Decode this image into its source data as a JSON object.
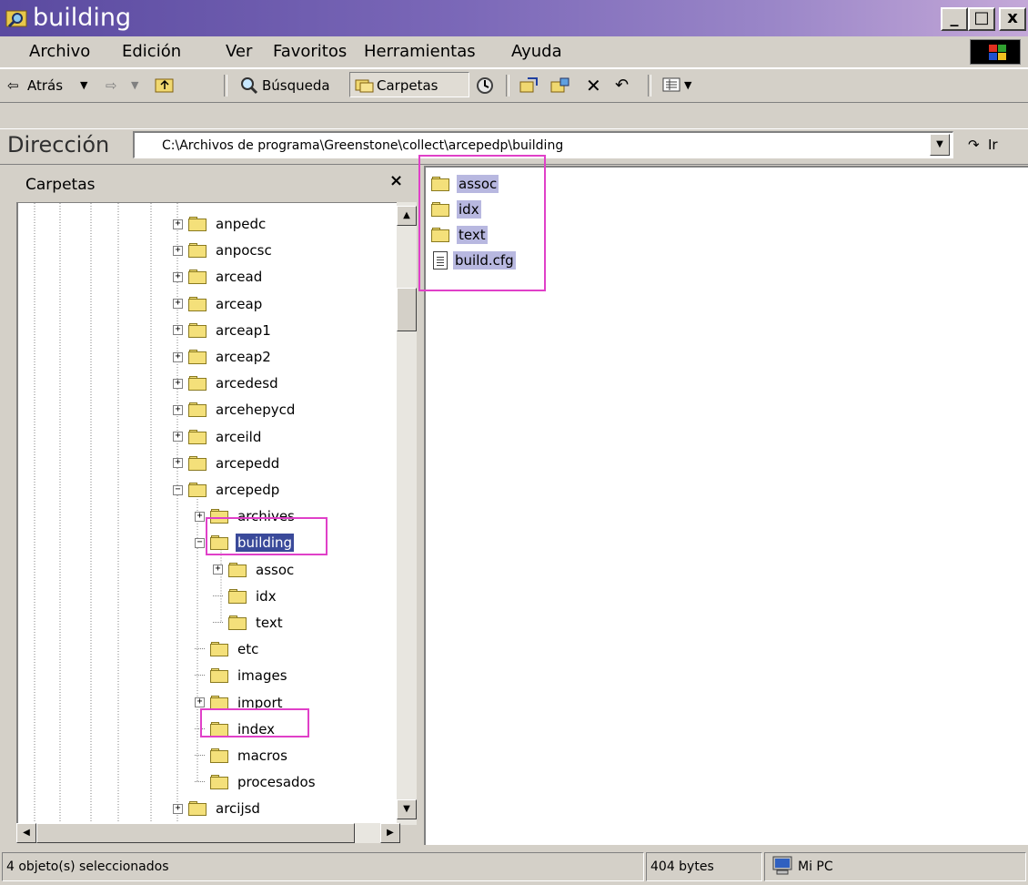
{
  "window": {
    "title": "building",
    "minimize": "_",
    "maximize": "□",
    "close": "x"
  },
  "menu": {
    "items": [
      "Archivo",
      "Edición",
      "Ver",
      "Favoritos",
      "Herramientas",
      "Ayuda"
    ]
  },
  "toolbar": {
    "back": "Atrás",
    "search": "Búsqueda",
    "folders": "Carpetas"
  },
  "address": {
    "label": "Dirección",
    "value": "C:\\Archivos de programa\\Greenstone\\collect\\arcepedp\\building",
    "go": "Ir"
  },
  "folder_pane": {
    "title": "Carpetas",
    "close": "×",
    "nodes": [
      {
        "label": "anpedc",
        "expander": "+"
      },
      {
        "label": "anpocsc",
        "expander": "+"
      },
      {
        "label": "arcead",
        "expander": "+"
      },
      {
        "label": "arceap",
        "expander": "+"
      },
      {
        "label": "arceap1",
        "expander": "+"
      },
      {
        "label": "arceap2",
        "expander": "+"
      },
      {
        "label": "arcedesd",
        "expander": "+"
      },
      {
        "label": "arcehepycd",
        "expander": "+"
      },
      {
        "label": "arceild",
        "expander": "+"
      },
      {
        "label": "arcepedd",
        "expander": "+"
      },
      {
        "label": "arcepedp",
        "expander": "−"
      },
      {
        "label": "archives",
        "expander": "+"
      },
      {
        "label": "building",
        "expander": "−",
        "selected": true
      },
      {
        "label": "assoc",
        "expander": "+"
      },
      {
        "label": "idx",
        "expander": ""
      },
      {
        "label": "text",
        "expander": ""
      },
      {
        "label": "etc",
        "expander": ""
      },
      {
        "label": "images",
        "expander": ""
      },
      {
        "label": "import",
        "expander": "+"
      },
      {
        "label": "index",
        "expander": ""
      },
      {
        "label": "macros",
        "expander": ""
      },
      {
        "label": "procesados",
        "expander": ""
      },
      {
        "label": "arcijsd",
        "expander": "+"
      }
    ]
  },
  "content": {
    "items": [
      {
        "label": "assoc",
        "type": "folder"
      },
      {
        "label": "idx",
        "type": "folder"
      },
      {
        "label": "text",
        "type": "folder"
      },
      {
        "label": "build.cfg",
        "type": "file"
      }
    ]
  },
  "status": {
    "selection": "4 objeto(s) seleccionados",
    "size": "404 bytes",
    "zone": "Mi PC"
  },
  "colors": {
    "title_gradient_start": "#5a4aa0",
    "highlight_box": "#e040c8",
    "selection": "#3a4a9a"
  }
}
